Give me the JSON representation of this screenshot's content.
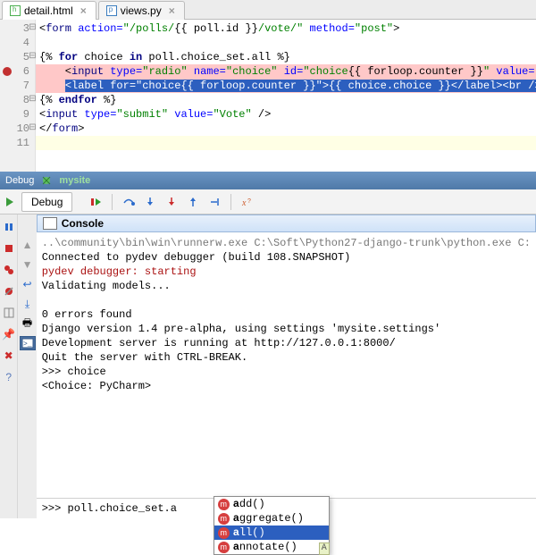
{
  "tabs": [
    {
      "label": "detail.html",
      "active": true
    },
    {
      "label": "views.py",
      "active": false
    }
  ],
  "editor": {
    "lines": [
      {
        "num": "3",
        "fold": "⊟",
        "bp": false,
        "cls": "",
        "html": "&lt;<span class='tag'>form</span> <span class='attr'>action=</span><span class='str'>\"/polls/</span>{{ poll.id }}<span class='str'>/vote/\"</span> <span class='attr'>method=</span><span class='str'>\"post\"</span>&gt;"
      },
      {
        "num": "4",
        "fold": "",
        "bp": false,
        "cls": "",
        "html": ""
      },
      {
        "num": "5",
        "fold": "⊟",
        "bp": false,
        "cls": "",
        "html": "{% <span class='kw'>for</span> choice <span class='kw'>in</span> poll.choice_set.all %}"
      },
      {
        "num": "6",
        "fold": "",
        "bp": true,
        "cls": "hl-pink",
        "html": "    &lt;<span class='tag'>input</span> <span class='attr'>type=</span><span class='str'>\"radio\"</span> <span class='attr'>name=</span><span class='str'>\"choice\"</span> <span class='attr'>id=</span><span class='str'>\"choice</span>{{ forloop.counter }}<span class='str'>\"</span> <span class='attr'>value=</span><span class='str'>\"</span>"
      },
      {
        "num": "7",
        "fold": "",
        "bp": false,
        "cls": "hl-blue",
        "html": "    <span class='sel'>&lt;label for=\"choice{{ forloop.counter }}\"&gt;{{ choice.choice }}&lt;/label&gt;&lt;br /&gt;</span>"
      },
      {
        "num": "8",
        "fold": "⊟",
        "bp": false,
        "cls": "",
        "html": "{% <span class='kw'>endfor</span> %}"
      },
      {
        "num": "9",
        "fold": "",
        "bp": false,
        "cls": "",
        "html": "&lt;<span class='tag'>input</span> <span class='attr'>type=</span><span class='str'>\"submit\"</span> <span class='attr'>value=</span><span class='str'>\"Vote\"</span> /&gt;"
      },
      {
        "num": "10",
        "fold": "⊟",
        "bp": false,
        "cls": "",
        "html": "&lt;/<span class='tag'>form</span>&gt;"
      },
      {
        "num": "11",
        "fold": "",
        "bp": false,
        "cls": "hl-last",
        "html": ""
      }
    ]
  },
  "debug": {
    "panel_label": "Debug",
    "config_name": "mysite",
    "tab_label": "Debug"
  },
  "console": {
    "title": "Console",
    "lines": [
      {
        "cls": "gray",
        "t": "..\\community\\bin\\win\\runnerw.exe C:\\Soft\\Python27-django-trunk\\python.exe C:"
      },
      {
        "cls": "",
        "t": "Connected to pydev debugger (build 108.SNAPSHOT)"
      },
      {
        "cls": "err",
        "t": "pydev debugger: starting"
      },
      {
        "cls": "",
        "t": "Validating models..."
      },
      {
        "cls": "",
        "t": ""
      },
      {
        "cls": "",
        "t": "0 errors found"
      },
      {
        "cls": "",
        "t": "Django version 1.4 pre-alpha, using settings 'mysite.settings'"
      },
      {
        "cls": "",
        "t": "Development server is running at http://127.0.0.1:8000/"
      },
      {
        "cls": "",
        "t": "Quit the server with CTRL-BREAK."
      },
      {
        "cls": "",
        "t": ">>> choice"
      },
      {
        "cls": "",
        "t": "<Choice: PyCharm>"
      }
    ],
    "input_prefix": ">>> ",
    "input_value": "poll.choice_set.a"
  },
  "completion": {
    "match_prefix": "a",
    "items": [
      {
        "rest": "dd()",
        "selected": false
      },
      {
        "rest": "ggregate()",
        "selected": false
      },
      {
        "rest": "ll()",
        "selected": true
      },
      {
        "rest": "nnotate()",
        "selected": false
      }
    ],
    "hint": "A"
  }
}
